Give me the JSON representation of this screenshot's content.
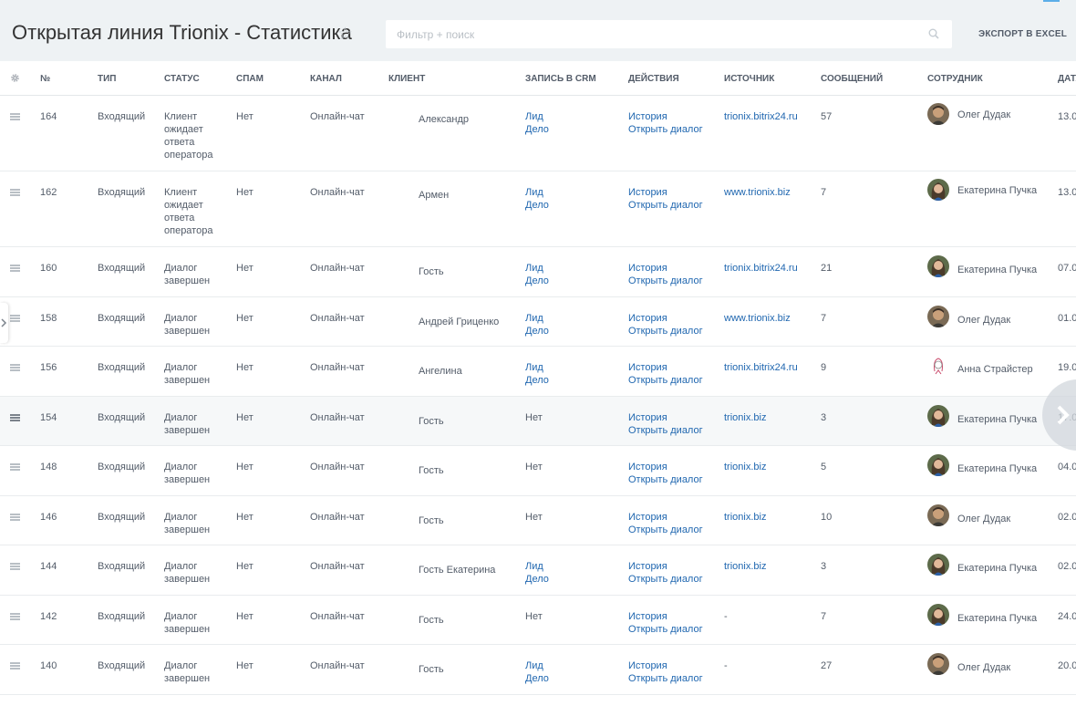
{
  "header": {
    "title": "Открытая линия Trionix - Статистика",
    "search_placeholder": "Фильтр + поиск",
    "export_label": "ЭКСПОРТ В EXCEL"
  },
  "columns": [
    "№",
    "ТИП",
    "СТАТУС",
    "СПАМ",
    "КАНАЛ",
    "КЛИЕНТ",
    "ЗАПИСЬ В CRM",
    "ДЕЙСТВИЯ",
    "ИСТОЧНИК",
    "СООБЩЕНИЙ",
    "СОТРУДНИК",
    "ДАТА"
  ],
  "actions": {
    "history": "История",
    "open_dialog": "Открыть диалог"
  },
  "rows": [
    {
      "num": "164",
      "type": "Входящий",
      "status": [
        "Клиент",
        "ожидает",
        "ответа",
        "оператора"
      ],
      "spam": "Нет",
      "channel": "Онлайн-чат",
      "client": "Александр",
      "crm": [
        "Лид",
        "Дело"
      ],
      "source": "trionix.bitrix24.ru",
      "messages": "57",
      "employee": "Олег Дудак",
      "avatar": "male",
      "date": "13.0"
    },
    {
      "num": "162",
      "type": "Входящий",
      "status": [
        "Клиент",
        "ожидает",
        "ответа",
        "оператора"
      ],
      "spam": "Нет",
      "channel": "Онлайн-чат",
      "client": "Армен",
      "crm": [
        "Лид",
        "Дело"
      ],
      "source": "www.trionix.biz",
      "messages": "7",
      "employee": "Екатерина Пучка",
      "avatar": "female",
      "date": "13.0"
    },
    {
      "num": "160",
      "type": "Входящий",
      "status": [
        "Диалог",
        "завершен"
      ],
      "spam": "Нет",
      "channel": "Онлайн-чат",
      "client": "Гость",
      "crm": [
        "Лид",
        "Дело"
      ],
      "source": "trionix.bitrix24.ru",
      "messages": "21",
      "employee": "Екатерина Пучка",
      "avatar": "female",
      "date": "07.0"
    },
    {
      "num": "158",
      "type": "Входящий",
      "status": [
        "Диалог",
        "завершен"
      ],
      "spam": "Нет",
      "channel": "Онлайн-чат",
      "client": "Андрей Гриценко",
      "crm": [
        "Лид",
        "Дело"
      ],
      "source": "www.trionix.biz",
      "messages": "7",
      "employee": "Олег Дудак",
      "avatar": "male",
      "date": "01.0"
    },
    {
      "num": "156",
      "type": "Входящий",
      "status": [
        "Диалог",
        "завершен"
      ],
      "spam": "Нет",
      "channel": "Онлайн-чат",
      "client": "Ангелина",
      "crm": [
        "Лид",
        "Дело"
      ],
      "source": "trionix.bitrix24.ru",
      "messages": "9",
      "employee": "Анна Страйстер",
      "avatar": "drawn",
      "date": "19.0"
    },
    {
      "num": "154",
      "type": "Входящий",
      "status": [
        "Диалог",
        "завершен"
      ],
      "spam": "Нет",
      "channel": "Онлайн-чат",
      "client": "Гость",
      "crm": [
        "Нет"
      ],
      "source": "trionix.biz",
      "messages": "3",
      "employee": "Екатерина Пучка",
      "avatar": "female",
      "date": "17.0",
      "highlight": true
    },
    {
      "num": "148",
      "type": "Входящий",
      "status": [
        "Диалог",
        "завершен"
      ],
      "spam": "Нет",
      "channel": "Онлайн-чат",
      "client": "Гость",
      "crm": [
        "Нет"
      ],
      "source": "trionix.biz",
      "messages": "5",
      "employee": "Екатерина Пучка",
      "avatar": "female",
      "date": "04.0"
    },
    {
      "num": "146",
      "type": "Входящий",
      "status": [
        "Диалог",
        "завершен"
      ],
      "spam": "Нет",
      "channel": "Онлайн-чат",
      "client": "Гость",
      "crm": [
        "Нет"
      ],
      "source": "trionix.biz",
      "messages": "10",
      "employee": "Олег Дудак",
      "avatar": "male",
      "date": "02.0"
    },
    {
      "num": "144",
      "type": "Входящий",
      "status": [
        "Диалог",
        "завершен"
      ],
      "spam": "Нет",
      "channel": "Онлайн-чат",
      "client": "Гость Екатерина",
      "crm": [
        "Лид",
        "Дело"
      ],
      "source": "trionix.biz",
      "messages": "3",
      "employee": "Екатерина Пучка",
      "avatar": "female",
      "date": "02.0"
    },
    {
      "num": "142",
      "type": "Входящий",
      "status": [
        "Диалог",
        "завершен"
      ],
      "spam": "Нет",
      "channel": "Онлайн-чат",
      "client": "Гость",
      "crm": [
        "Нет"
      ],
      "source": "-",
      "messages": "7",
      "employee": "Екатерина Пучка",
      "avatar": "female",
      "date": "24.0"
    },
    {
      "num": "140",
      "type": "Входящий",
      "status": [
        "Диалог",
        "завершен"
      ],
      "spam": "Нет",
      "channel": "Онлайн-чат",
      "client": "Гость",
      "crm": [
        "Лид",
        "Дело"
      ],
      "source": "-",
      "messages": "27",
      "employee": "Олег Дудак",
      "avatar": "male",
      "date": "20.0"
    }
  ],
  "colors": {
    "link": "#2067b0",
    "text": "#535c69",
    "background": "#eef2f4"
  },
  "icons": [
    "star-icon",
    "search-icon",
    "gear-icon",
    "drag-handle-icon",
    "chevron-left-icon",
    "chevron-right-icon"
  ]
}
